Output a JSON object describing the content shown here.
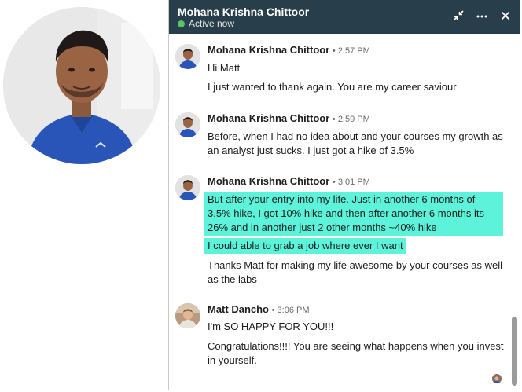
{
  "profile": {
    "icon": "profile-photo-icon"
  },
  "header": {
    "name": "Mohana Krishna Chittoor",
    "status": "Active now",
    "status_color": "#57c46a",
    "bg_color": "#283e4a",
    "icons": [
      "minimize-icon",
      "more-options-icon",
      "close-icon"
    ]
  },
  "messages": [
    {
      "sender": "Mohana Krishna Chittoor",
      "time": "• 2:57 PM",
      "lines": [
        "Hi Matt",
        "I just wanted to thank again. You are my career saviour"
      ]
    },
    {
      "sender": "Mohana Krishna Chittoor",
      "time": "• 2:59 PM",
      "lines": [
        "Before, when I had no idea about and your courses my growth as an analyst just sucks. I just got a hike of 3.5%"
      ]
    },
    {
      "sender": "Mohana Krishna Chittoor",
      "time": "• 3:01 PM",
      "lines": [
        "But after your entry into my life. Just in another 6 months of 3.5% hike, I got 10% hike and then after another 6 months its 26% and in another just 2 other months ~40% hike",
        "I could able to grab a job where ever I want",
        "Thanks Matt for making my life awesome by your courses as well as the labs"
      ]
    },
    {
      "sender": "Matt Dancho",
      "time": "• 3:06 PM",
      "lines": [
        "I'm SO HAPPY FOR YOU!!!",
        "Congratulations!!!! You are seeing what happens when you invest in yourself."
      ]
    }
  ],
  "highlight_color": "#5cf3da"
}
